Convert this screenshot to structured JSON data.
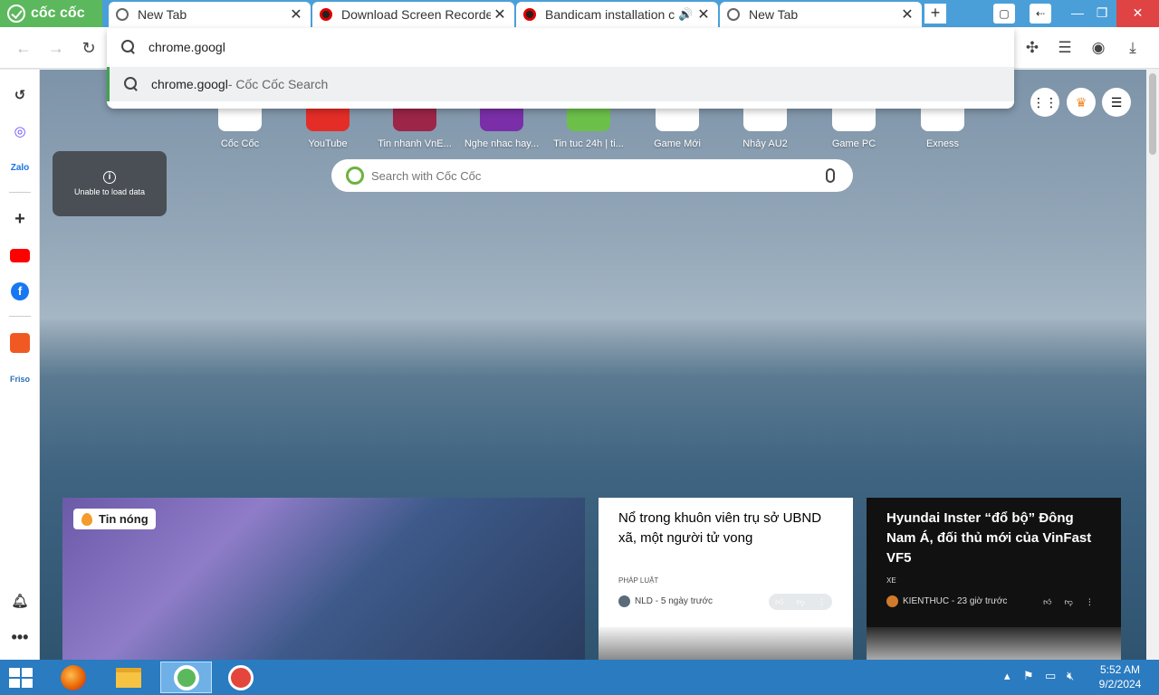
{
  "browser": {
    "brand": "cốc cốc",
    "tabs": [
      {
        "title": "New Tab",
        "icon": "coccoc-icon"
      },
      {
        "title": "Download Screen Recorde",
        "icon": "record-icon"
      },
      {
        "title": "Bandicam installation c",
        "icon": "record-icon",
        "audio": true
      },
      {
        "title": "New Tab",
        "icon": "coccoc-icon",
        "active": true
      }
    ],
    "new_tab_label": "+",
    "window_controls": {
      "minimize": "—",
      "maximize": "❐",
      "close": "✕"
    }
  },
  "omnibox": {
    "query": "chrome.googl",
    "suggestion": {
      "text": "chrome.googl",
      "source": " - Cốc Cốc Search"
    }
  },
  "sidebar": {
    "items": [
      {
        "name": "history-icon"
      },
      {
        "name": "messenger-icon"
      },
      {
        "name": "zalo-icon"
      },
      {
        "name": "add-icon"
      },
      {
        "name": "youtube-icon"
      },
      {
        "name": "facebook-icon"
      },
      {
        "name": "shopee-icon"
      },
      {
        "name": "friso-icon"
      },
      {
        "name": "bell-icon"
      },
      {
        "name": "more-icon"
      }
    ]
  },
  "speed_dial": {
    "tiles": [
      {
        "label": "Cốc Cốc",
        "color": "#ffffff"
      },
      {
        "label": "YouTube",
        "color": "#ff0000"
      },
      {
        "label": "Tin nhanh VnE...",
        "color": "#9c2548"
      },
      {
        "label": "Nghe nhac hay...",
        "color": "#7a2fa8"
      },
      {
        "label": "Tin tuc 24h | ti...",
        "color": "#6cc04a"
      },
      {
        "label": "Game Mới",
        "color": "#ffffff"
      },
      {
        "label": "Nhảy AU2",
        "color": "#ffffff"
      },
      {
        "label": "Game PC",
        "color": "#ffffff"
      },
      {
        "label": "Exness",
        "color": "#ffffff"
      }
    ]
  },
  "search": {
    "placeholder": "Search with Cốc Cốc"
  },
  "error_card": {
    "text": "Unable to load data",
    "icon": "info-icon"
  },
  "news": {
    "hot_badge": "Tin nóng",
    "cards": [
      {
        "title": "Nổ trong khuôn viên trụ sở UBND xã, một người tử vong",
        "category": "PHÁP LUẬT",
        "source": "NLD - 5 ngày trước"
      },
      {
        "title": "Hyundai Inster “đổ bộ” Đông Nam Á, đối thủ mới của VinFast VF5",
        "category": "XE",
        "source": "KIENTHUC - 23 giờ trước"
      }
    ]
  },
  "taskbar": {
    "time": "5:52 AM",
    "date": "9/2/2024",
    "apps": [
      {
        "name": "firefox-icon"
      },
      {
        "name": "file-explorer-icon"
      },
      {
        "name": "coccoc-icon",
        "active": true
      },
      {
        "name": "bandicam-icon"
      }
    ]
  },
  "colors": {
    "tabstrip": "#4b9fd9",
    "brand_green": "#5cb85c",
    "taskbar": "#2a7bc0"
  }
}
